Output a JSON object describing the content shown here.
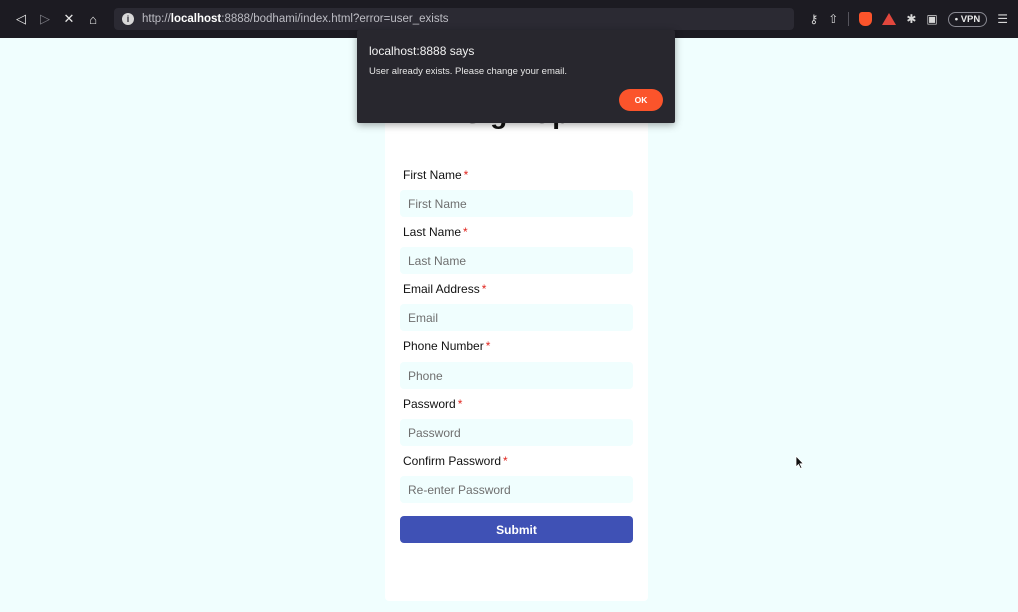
{
  "browser": {
    "url_prefix": "http://",
    "url_host": "localhost",
    "url_rest": ":8888/bodhami/index.html?error=user_exists",
    "vpn_label": "• VPN"
  },
  "dialog": {
    "origin": "localhost:8888 says",
    "message": "User already exists. Please change your email.",
    "ok_label": "OK"
  },
  "form": {
    "title": "Sign Up",
    "fields": [
      {
        "label": "First Name",
        "placeholder": "First Name"
      },
      {
        "label": "Last Name",
        "placeholder": "Last Name"
      },
      {
        "label": "Email Address",
        "placeholder": "Email"
      },
      {
        "label": "Phone Number",
        "placeholder": "Phone"
      },
      {
        "label": "Password",
        "placeholder": "Password"
      },
      {
        "label": "Confirm Password",
        "placeholder": "Re-enter Password"
      }
    ],
    "required_mark": "*",
    "submit_label": "Submit"
  },
  "colors": {
    "page_bg": "#f0fefe",
    "submit_bg": "#3f51b5",
    "required": "#e0241d",
    "dialog_ok": "#fb542b"
  }
}
